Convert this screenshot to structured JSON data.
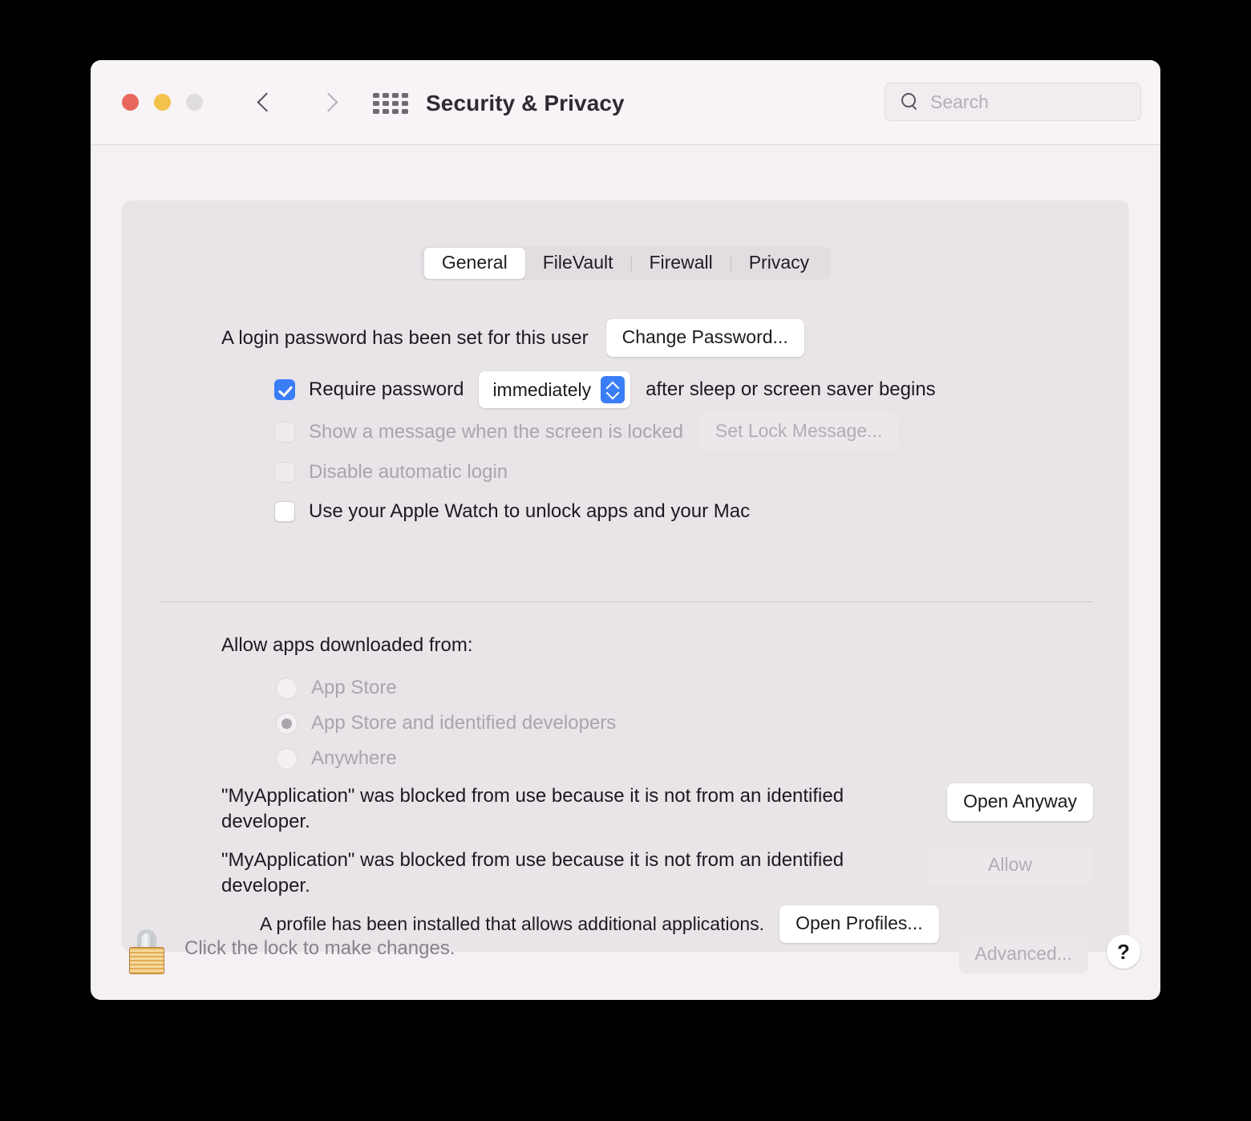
{
  "window": {
    "title": "Security & Privacy",
    "traffic_lights": [
      "close",
      "minimize",
      "zoom"
    ],
    "grid_icon": "show-all-grid-icon",
    "back_icon": "chevron-left-icon",
    "forward_icon": "chevron-right-icon"
  },
  "search": {
    "placeholder": "Search",
    "value": "",
    "icon": "search-icon"
  },
  "tabs": [
    {
      "label": "General",
      "active": true
    },
    {
      "label": "FileVault",
      "active": false
    },
    {
      "label": "Firewall",
      "active": false
    },
    {
      "label": "Privacy",
      "active": false
    }
  ],
  "login": {
    "status_text": "A login password has been set for this user",
    "change_password_label": "Change Password...",
    "require_password": {
      "checked": true,
      "label_before": "Require password",
      "value": "immediately",
      "label_after": "after sleep or screen saver begins"
    },
    "show_message": {
      "checked": false,
      "enabled": false,
      "label": "Show a message when the screen is locked",
      "button_label": "Set Lock Message..."
    },
    "disable_auto_login": {
      "checked": false,
      "enabled": false,
      "label": "Disable automatic login"
    },
    "apple_watch": {
      "checked": false,
      "enabled": true,
      "label": "Use your Apple Watch to unlock apps and your Mac"
    }
  },
  "gatekeeper": {
    "heading": "Allow apps downloaded from:",
    "options": [
      {
        "label": "App Store",
        "selected": false,
        "enabled": false
      },
      {
        "label": "App Store and identified developers",
        "selected": true,
        "enabled": false
      },
      {
        "label": "Anywhere",
        "selected": false,
        "enabled": false
      }
    ],
    "blocked_messages": [
      {
        "text": "\"MyApplication\" was blocked from use because it is not from an identified developer.",
        "button_label": "Open Anyway",
        "button_enabled": true
      },
      {
        "text": "\"MyApplication\" was blocked from use because it is not from an identified developer.",
        "button_label": "Allow",
        "button_enabled": false
      }
    ],
    "profile_note": "A profile has been installed that allows additional applications.",
    "profile_button_label": "Open Profiles..."
  },
  "footer": {
    "lock_icon": "closed-padlock-icon",
    "lock_text": "Click the lock to make changes.",
    "advanced_label": "Advanced...",
    "advanced_enabled": false,
    "help_label": "?"
  },
  "colors": {
    "accent": "#3a7ef7",
    "window_bg": "#f4f0f3",
    "panel_bg": "#e9e4e8",
    "text": "#1c1a1f",
    "text_disabled": "#aaa5ab",
    "close": "#e8675d",
    "minimize": "#f2c24a",
    "zoom": "#dedcdd"
  }
}
